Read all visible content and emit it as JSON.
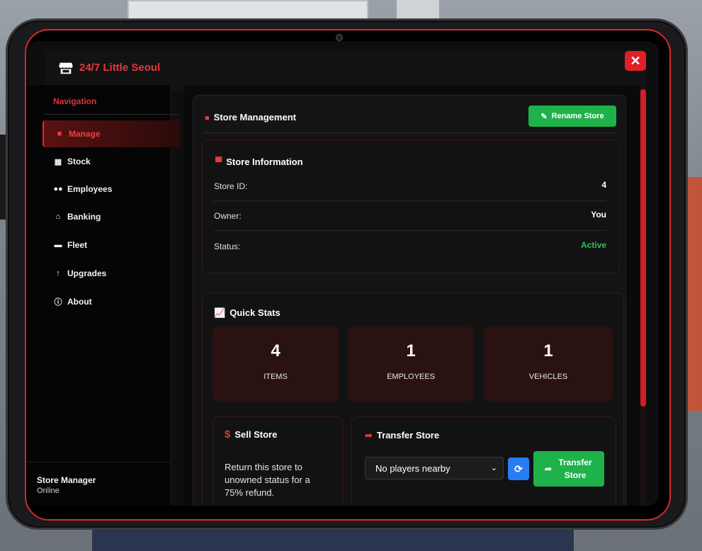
{
  "header": {
    "title": "24/7 Little Seoul",
    "close_label": "✕"
  },
  "sidebar": {
    "heading": "Navigation",
    "items": [
      {
        "label": "Manage",
        "icon": "briefcase-icon",
        "active": true
      },
      {
        "label": "Stock",
        "icon": "boxes-icon"
      },
      {
        "label": "Employees",
        "icon": "users-icon"
      },
      {
        "label": "Banking",
        "icon": "bank-icon"
      },
      {
        "label": "Fleet",
        "icon": "truck-icon"
      },
      {
        "label": "Upgrades",
        "icon": "arrow-up-icon"
      },
      {
        "label": "About",
        "icon": "info-icon"
      }
    ],
    "footer": {
      "name": "Store Manager",
      "status": "Online"
    }
  },
  "management": {
    "title": "Store Management",
    "rename_label": "Rename Store",
    "info": {
      "title": "Store Information",
      "rows": [
        {
          "label": "Store ID:",
          "value": "4"
        },
        {
          "label": "Owner:",
          "value": "You"
        },
        {
          "label": "Status:",
          "value": "Active"
        }
      ]
    },
    "stats": {
      "title": "Quick Stats",
      "boxes": [
        {
          "value": "4",
          "label": "ITEMS"
        },
        {
          "value": "1",
          "label": "EMPLOYEES"
        },
        {
          "value": "1",
          "label": "VEHICLES"
        }
      ]
    },
    "sell": {
      "title": "Sell Store",
      "description": "Return this store to unowned status for a 75% refund."
    },
    "transfer": {
      "title": "Transfer Store",
      "select_value": "No players nearby",
      "button_label": "Transfer Store"
    }
  },
  "colors": {
    "accent": "#e23a3e",
    "success": "#1fb24a",
    "info": "#2a7cf2"
  }
}
